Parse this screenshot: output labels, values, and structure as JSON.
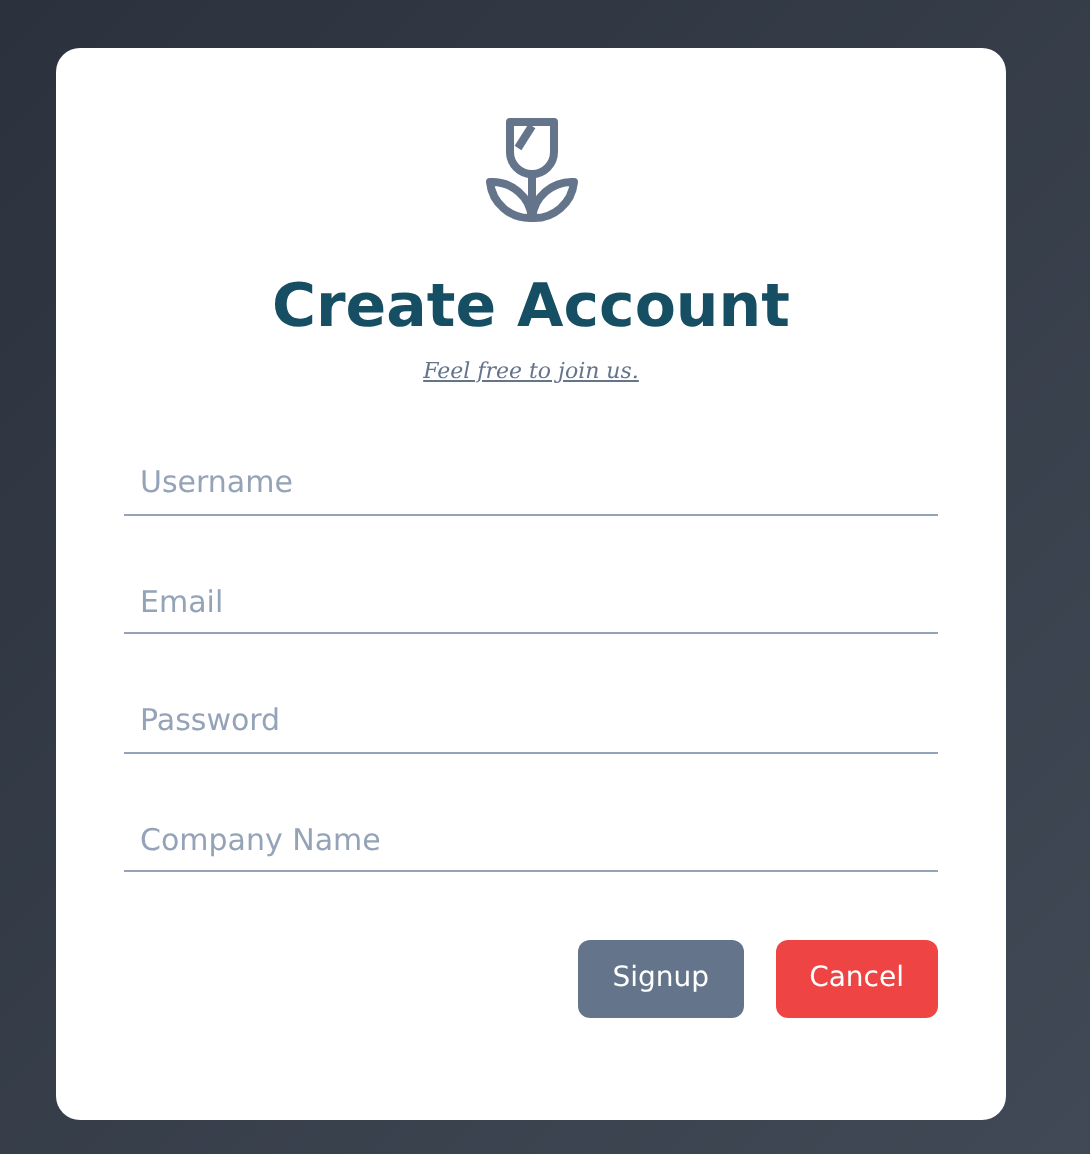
{
  "title": "Create Account",
  "subtitle": "Feel free to join us.",
  "fields": [
    {
      "placeholder": "Username"
    },
    {
      "placeholder": "Email"
    },
    {
      "placeholder": "Password"
    },
    {
      "placeholder": "Company Name"
    }
  ],
  "buttons": [
    {
      "label": "Signup",
      "kind": "secondary"
    },
    {
      "label": "Cancel",
      "kind": "danger"
    }
  ]
}
